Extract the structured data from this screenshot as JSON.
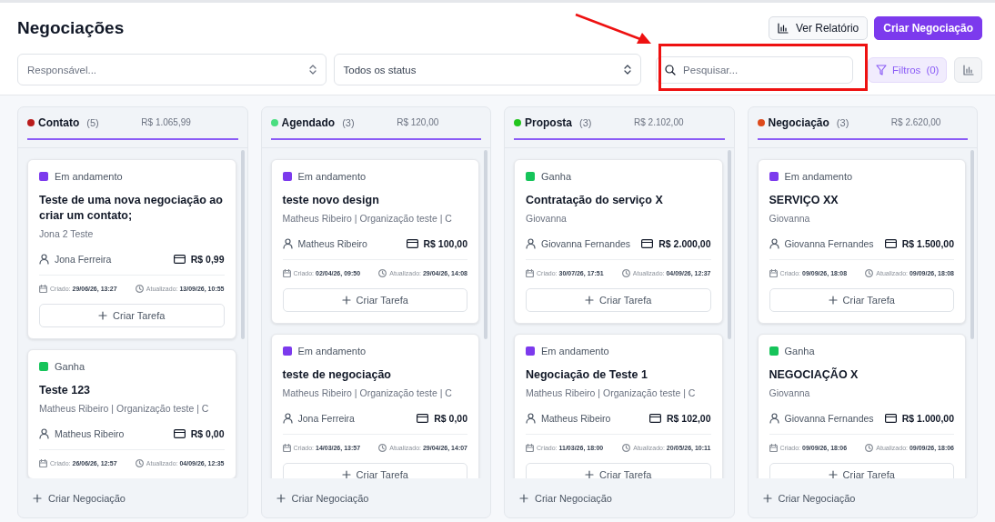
{
  "page_title": "Negociações",
  "header_buttons": [
    {
      "kind": "report",
      "label": "Ver Relatório"
    },
    {
      "kind": "primary",
      "label": "Criar Negociação"
    }
  ],
  "filters": {
    "responsible": {
      "placeholder": "Responsável..."
    },
    "status": {
      "value": "Todos os status"
    },
    "search": {
      "placeholder": "Pesquisar..."
    },
    "filters_button": {
      "label": "Filtros",
      "count": "(0)"
    }
  },
  "columns": [
    {
      "name": "Contato",
      "count": "(5)",
      "total": "R$ 1.065,99",
      "color": "#b91c1c",
      "add_label": "Criar Negociação",
      "cards": [
        {
          "status": "Em andamento",
          "color": "#7c3aed",
          "title": "Teste de uma nova negociação ao criar um contato;",
          "subtitle": "Jona 2 Teste",
          "owner": "Jona Ferreira",
          "value": "R$ 0,99",
          "created": "Criado: **29/06/26, 13:27**",
          "updated": "Atualizado: **13/09/26, 10:55**",
          "task_label": "Criar Tarefa"
        },
        {
          "status": "Ganha",
          "color": "#16c45a",
          "title": "Teste 123",
          "subtitle": "Matheus Ribeiro | Organização teste | C",
          "owner": "Matheus Ribeiro",
          "value": "R$ 0,00",
          "created": "Criado: **26/06/26, 12:57**",
          "updated": "Atualizado: **04/09/26, 12:35**"
        }
      ]
    },
    {
      "name": "Agendado",
      "count": "(3)",
      "total": "R$ 120,00",
      "color": "#4ade80",
      "add_label": "Criar Negociação",
      "cards": [
        {
          "status": "Em andamento",
          "color": "#7c3aed",
          "title": "teste novo design",
          "subtitle": "Matheus Ribeiro | Organização teste | C",
          "owner": "Matheus Ribeiro",
          "value": "R$ 100,00",
          "created": "Criado: **02/04/26, 09:50**",
          "updated": "Atualizado: **29/04/26, 14:08**",
          "task_label": "Criar Tarefa"
        },
        {
          "status": "Em andamento",
          "color": "#7c3aed",
          "title": "teste de negociação",
          "subtitle": "Matheus Ribeiro | Organização teste | C",
          "owner": "Jona Ferreira",
          "value": "R$ 0,00",
          "created": "Criado: **14/03/26, 13:57**",
          "updated": "Atualizado: **29/04/26, 14:07**",
          "task_label": "Criar Tarefa"
        }
      ]
    },
    {
      "name": "Proposta",
      "count": "(3)",
      "total": "R$ 2.102,00",
      "color": "#22c51e",
      "add_label": "Criar Negociação",
      "cards": [
        {
          "status": "Ganha",
          "color": "#16c45a",
          "title": "Contratação do serviço X",
          "subtitle": "Giovanna",
          "owner": "Giovanna Fernandes",
          "value": "R$ 2.000,00",
          "created": "Criado: **30/07/26, 17:51**",
          "updated": "Atualizado: **04/09/26, 12:37**",
          "task_label": "Criar Tarefa"
        },
        {
          "status": "Em andamento",
          "color": "#7c3aed",
          "title": "Negociação de Teste 1",
          "subtitle": "Matheus Ribeiro | Organização teste | C",
          "owner": "Matheus Ribeiro",
          "value": "R$ 102,00",
          "created": "Criado: **11/03/26, 18:00**",
          "updated": "Atualizado: **20/05/26, 10:11**",
          "task_label": "Criar Tarefa"
        }
      ]
    },
    {
      "name": "Negociação",
      "count": "(3)",
      "total": "R$ 2.620,00",
      "color": "#dd4a1c",
      "add_label": "Criar Negociação",
      "cards": [
        {
          "status": "Em andamento",
          "color": "#7c3aed",
          "title": "SERVIÇO XX",
          "subtitle": "Giovanna",
          "owner": "Giovanna Fernandes",
          "value": "R$ 1.500,00",
          "created": "Criado: **09/09/26, 18:08**",
          "updated": "Atualizado: **09/09/26, 18:08**",
          "task_label": "Criar Tarefa"
        },
        {
          "status": "Ganha",
          "color": "#16c45a",
          "title": "NEGOCIAÇÃO X",
          "subtitle": "Giovanna",
          "owner": "Giovanna Fernandes",
          "value": "R$ 1.000,00",
          "created": "Criado: **09/09/26, 18:06**",
          "updated": "Atualizado: **09/09/26, 18:06**",
          "task_label": "Criar Tarefa"
        }
      ]
    }
  ]
}
